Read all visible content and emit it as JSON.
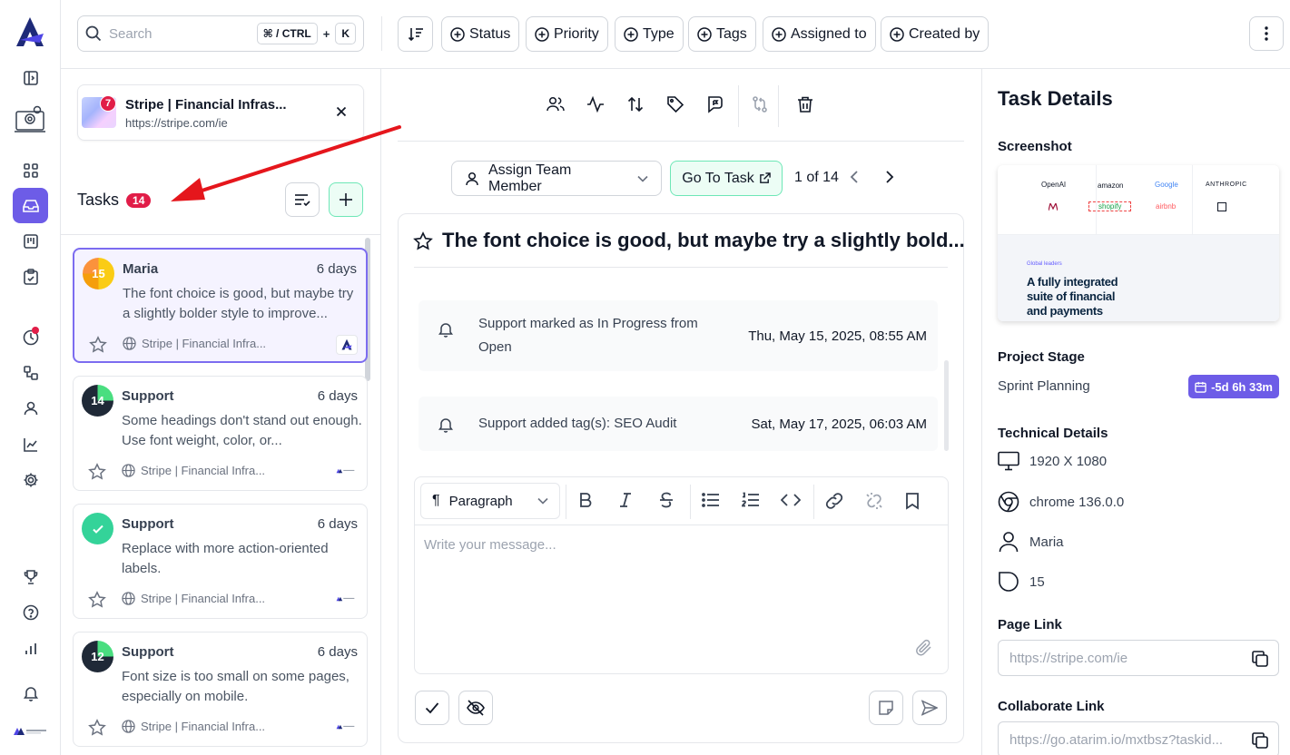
{
  "topbar": {
    "search_placeholder": "Search",
    "shortcut_mod": "⌘ / CTRL",
    "shortcut_plus": "+",
    "shortcut_key": "K",
    "filters": [
      "Status",
      "Priority",
      "Type",
      "Tags",
      "Assigned to",
      "Created by"
    ]
  },
  "site": {
    "title": "Stripe | Financial Infras...",
    "url": "https://stripe.com/ie",
    "badge": "7"
  },
  "tasks": {
    "label": "Tasks",
    "count": "14",
    "items": [
      {
        "badge": "15",
        "name": "Maria",
        "when": "6 days",
        "text": "The font choice is good, but maybe try a slightly bolder style to improve...",
        "site": "Stripe | Financial Infra..."
      },
      {
        "badge": "14",
        "name": "Support",
        "when": "6 days",
        "text": "Some headings don't stand out enough. Use font weight, color, or...",
        "site": "Stripe | Financial Infra..."
      },
      {
        "badge": "",
        "name": "Support",
        "when": "6 days",
        "text": "Replace with more action-oriented labels.",
        "site": "Stripe | Financial Infra..."
      },
      {
        "badge": "12",
        "name": "Support",
        "when": "6 days",
        "text": "Font size is too small on some pages, especially on mobile.",
        "site": "Stripe | Financial Infra..."
      }
    ]
  },
  "center": {
    "assign_label": "Assign Team Member",
    "goto_label": "Go To Task",
    "pager": "1 of 14",
    "title": "The font choice is good, but maybe try a slightly bold...",
    "activity": [
      {
        "text": "Support marked as In Progress from Open",
        "date": "Thu, May 15, 2025, 08:55 AM"
      },
      {
        "text": "Support added tag(s): SEO Audit",
        "date": "Sat, May 17, 2025, 06:03 AM"
      }
    ],
    "editor": {
      "block_type": "Paragraph",
      "placeholder": "Write your message..."
    }
  },
  "details": {
    "title": "Task Details",
    "screenshot_label": "Screenshot",
    "screenshot": {
      "logos": [
        "OpenAI",
        "amazon",
        "Google",
        "ANTHROPIC",
        "shopify",
        "airbnb"
      ],
      "kicker": "Global leaders",
      "headline": "A fully integrated suite of financial and payments"
    },
    "stage_label": "Project Stage",
    "stage": "Sprint Planning",
    "stage_due": "-5d 6h 33m",
    "tech_label": "Technical Details",
    "resolution": "1920 X 1080",
    "browser": "chrome 136.0.0",
    "user": "Maria",
    "task_id": "15",
    "page_link_label": "Page Link",
    "page_link": "https://stripe.com/ie",
    "collab_label": "Collaborate Link",
    "collab_link": "https://go.atarim.io/mxtbsz?taskid..."
  },
  "colors": {
    "accent": "#6d5ce7",
    "badge_red": "#e11d48",
    "green_btn": "#ecfdf5",
    "arrow": "#e5161c"
  }
}
